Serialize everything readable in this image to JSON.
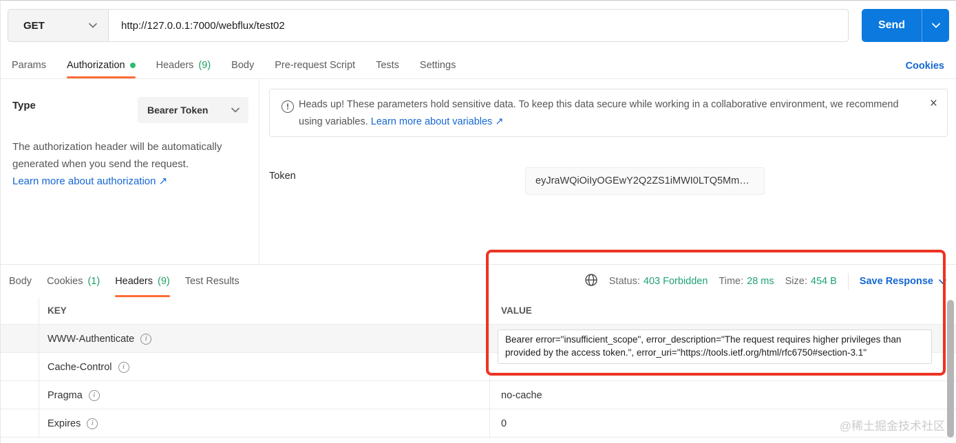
{
  "request_bar": {
    "method": "GET",
    "url": "http://127.0.0.1:7000/webflux/test02",
    "send_label": "Send"
  },
  "request_tabs": {
    "items": [
      {
        "label": "Params"
      },
      {
        "label": "Authorization"
      },
      {
        "label": "Headers",
        "count": "(9)"
      },
      {
        "label": "Body"
      },
      {
        "label": "Pre-request Script"
      },
      {
        "label": "Tests"
      },
      {
        "label": "Settings"
      }
    ],
    "cookies_link": "Cookies"
  },
  "auth_panel": {
    "type_label": "Type",
    "type_value": "Bearer Token",
    "description": "The authorization header will be automatically generated when you send the request.",
    "learn_link": "Learn more about authorization",
    "link_arrow": "↗"
  },
  "warning_banner": {
    "icon": "!",
    "text": "Heads up! These parameters hold sensitive data. To keep this data secure while working in a collaborative environment, we recommend using variables.",
    "link": "Learn more about variables",
    "link_arrow": "↗",
    "close": "×"
  },
  "token_row": {
    "label": "Token",
    "value": "eyJraWQiOiIyOGEwY2Q2ZS1iMWI0LTQ5Mm…"
  },
  "response": {
    "tabs": [
      {
        "label": "Body"
      },
      {
        "label": "Cookies",
        "count": "(1)"
      },
      {
        "label": "Headers",
        "count": "(9)"
      },
      {
        "label": "Test Results"
      }
    ],
    "status": {
      "status_label": "Status:",
      "status_value": "403 Forbidden",
      "time_label": "Time:",
      "time_value": "28 ms",
      "size_label": "Size:",
      "size_value": "454 B",
      "save_label": "Save Response"
    },
    "headers_table": {
      "key_header": "KEY",
      "value_header": "VALUE",
      "rows": [
        {
          "key": "WWW-Authenticate",
          "value": "Bearer error=\"insufficient_scope\", error_description=\"The request requires higher privileges than provided by the access token.\", error_uri=\"https://tools.ietf.org/html/rfc6750#section-3.1\""
        },
        {
          "key": "Cache-Control",
          "value": ""
        },
        {
          "key": "Pragma",
          "value": "no-cache"
        },
        {
          "key": "Expires",
          "value": "0"
        }
      ]
    }
  },
  "watermark": "@稀土掘金技术社区",
  "colors": {
    "accent": "#ff6c37",
    "green": "#1f9e63",
    "dot_green": "#2dbd6e",
    "status_green": "#1ea178",
    "link_blue": "#1567d3",
    "send_blue": "#0b79dd",
    "annotation_red": "#ec3323"
  }
}
